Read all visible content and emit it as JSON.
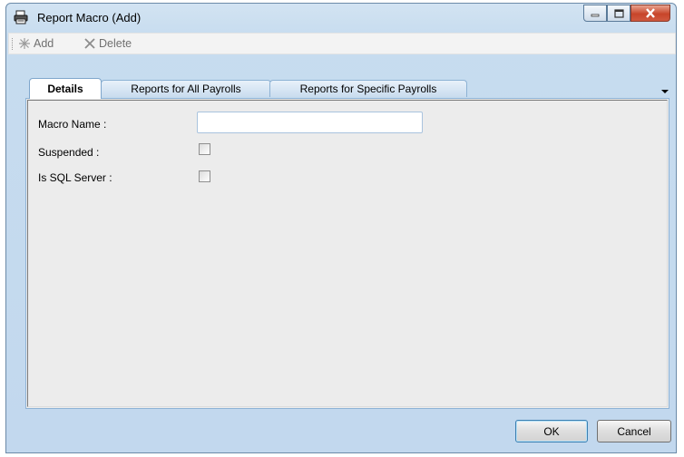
{
  "window": {
    "title": "Report Macro (Add)",
    "icon": "printer-icon"
  },
  "toolbar": {
    "add_label": "Add",
    "delete_label": "Delete"
  },
  "tabs": [
    {
      "label": "Details",
      "active": true
    },
    {
      "label": "Reports for All Payrolls",
      "active": false
    },
    {
      "label": "Reports for Specific Payrolls",
      "active": false
    }
  ],
  "form": {
    "macro_name_label": "Macro Name :",
    "macro_name_value": "",
    "suspended_label": "Suspended :",
    "suspended_checked": false,
    "sql_server_label": "Is SQL Server :",
    "sql_server_checked": false
  },
  "buttons": {
    "ok": "OK",
    "cancel": "Cancel"
  }
}
